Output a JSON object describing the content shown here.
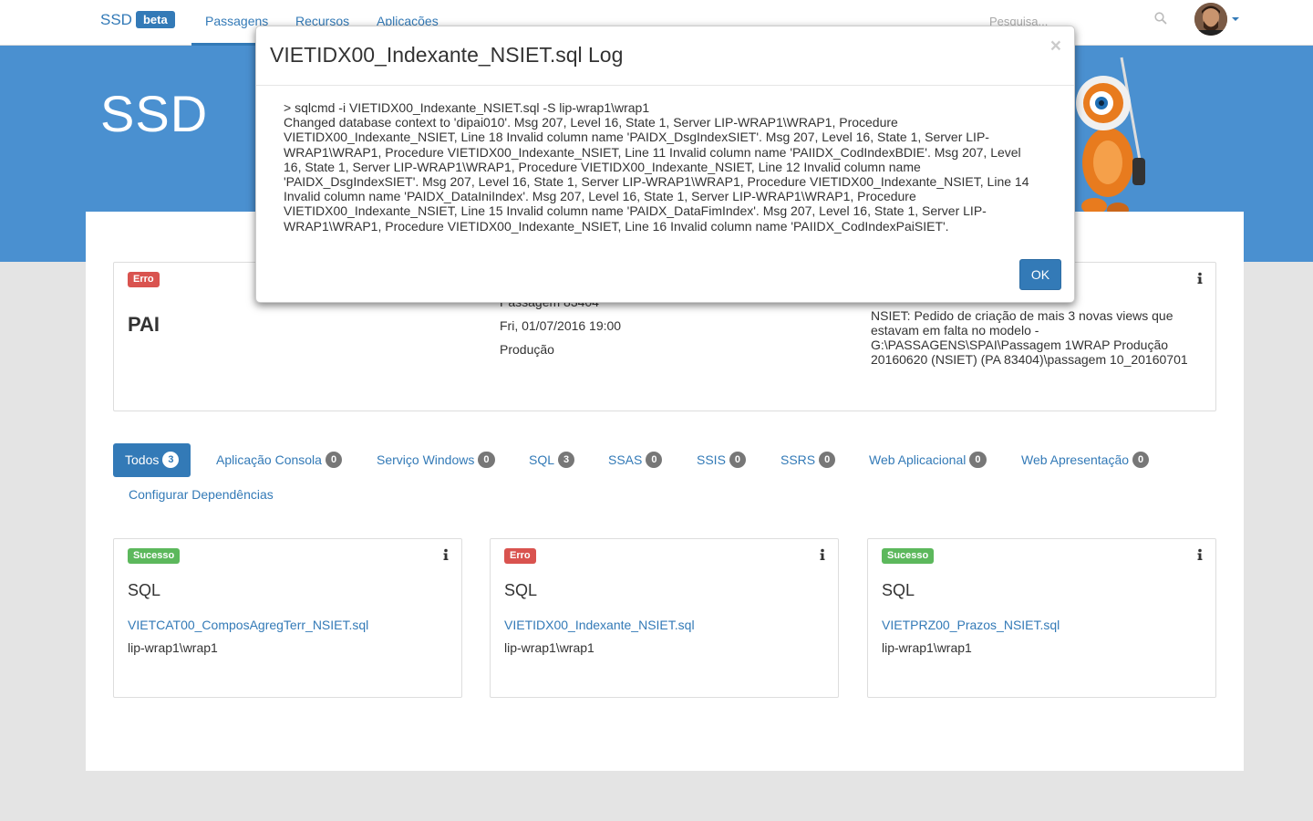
{
  "navbar": {
    "brand": "SSD",
    "brand_badge": "beta",
    "items": [
      {
        "label": "Passagens"
      },
      {
        "label": "Recursos"
      },
      {
        "label": "Aplicações"
      }
    ],
    "search_placeholder": "Pesquisa..."
  },
  "hero": {
    "title": "SSD"
  },
  "summary": {
    "status": "Erro",
    "name": "PAI",
    "passagem": "Passagem 83404",
    "date": "Fri, 01/07/2016 19:00",
    "environment": "Produção",
    "description": "NSIET: Pedido de criação de mais 3 novas views que estavam em falta no modelo - G:\\PASSAGENS\\SPAI\\Passagem 1WRAP Produção 20160620 (NSIET) (PA 83404)\\passagem 10_20160701"
  },
  "tabs": [
    {
      "label": "Todos",
      "count": "3"
    },
    {
      "label": "Aplicação Consola",
      "count": "0"
    },
    {
      "label": "Serviço Windows",
      "count": "0"
    },
    {
      "label": "SQL",
      "count": "3"
    },
    {
      "label": "SSAS",
      "count": "0"
    },
    {
      "label": "SSIS",
      "count": "0"
    },
    {
      "label": "SSRS",
      "count": "0"
    },
    {
      "label": "Web Aplicacional",
      "count": "0"
    },
    {
      "label": "Web Apresentação",
      "count": "0"
    }
  ],
  "config_link": "Configurar Dependências",
  "cards": [
    {
      "status": "Sucesso",
      "type": "SQL",
      "file": "VIETCAT00_ComposAgregTerr_NSIET.sql",
      "server": "lip-wrap1\\wrap1"
    },
    {
      "status": "Erro",
      "type": "SQL",
      "file": "VIETIDX00_Indexante_NSIET.sql",
      "server": "lip-wrap1\\wrap1"
    },
    {
      "status": "Sucesso",
      "type": "SQL",
      "file": "VIETPRZ00_Prazos_NSIET.sql",
      "server": "lip-wrap1\\wrap1"
    }
  ],
  "modal": {
    "title": "VIETIDX00_Indexante_NSIET.sql Log",
    "close": "×",
    "log_line1": "> sqlcmd -i VIETIDX00_Indexante_NSIET.sql -S lip-wrap1\\wrap1",
    "log_body": "Changed database context to 'dipai010'. Msg 207, Level 16, State 1, Server LIP-WRAP1\\WRAP1, Procedure VIETIDX00_Indexante_NSIET, Line 18 Invalid column name 'PAIDX_DsgIndexSIET'. Msg 207, Level 16, State 1, Server LIP-WRAP1\\WRAP1, Procedure VIETIDX00_Indexante_NSIET, Line 11 Invalid column name 'PAIIDX_CodIndexBDIE'. Msg 207, Level 16, State 1, Server LIP-WRAP1\\WRAP1, Procedure VIETIDX00_Indexante_NSIET, Line 12 Invalid column name 'PAIDX_DsgIndexSIET'. Msg 207, Level 16, State 1, Server LIP-WRAP1\\WRAP1, Procedure VIETIDX00_Indexante_NSIET, Line 14 Invalid column name 'PAIDX_DataIniIndex'. Msg 207, Level 16, State 1, Server LIP-WRAP1\\WRAP1, Procedure VIETIDX00_Indexante_NSIET, Line 15 Invalid column name 'PAIDX_DataFimIndex'. Msg 207, Level 16, State 1, Server LIP-WRAP1\\WRAP1, Procedure VIETIDX00_Indexante_NSIET, Line 16 Invalid column name 'PAIIDX_CodIndexPaiSIET'.",
    "ok_label": "OK"
  },
  "colors": {
    "primary": "#337ab7",
    "hero": "#4a90d0",
    "danger": "#d9534f",
    "success": "#5cb85c"
  }
}
